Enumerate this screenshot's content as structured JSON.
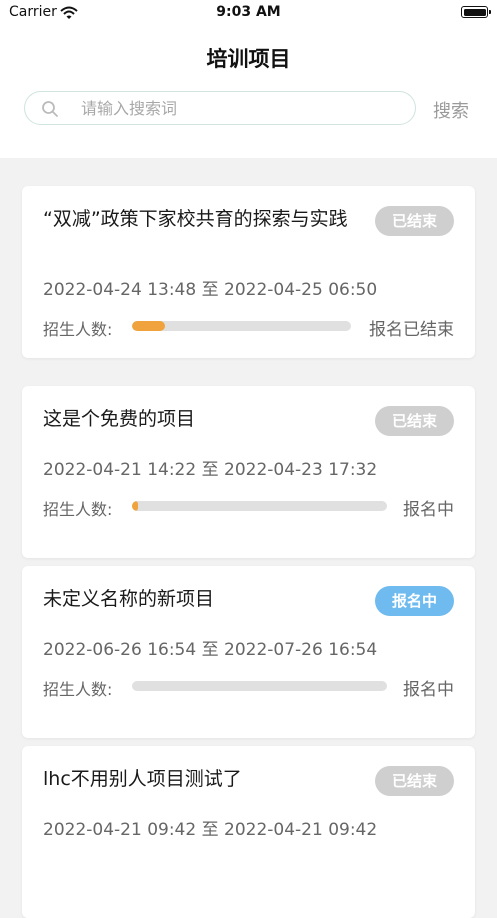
{
  "status_bar": {
    "carrier": "Carrier",
    "time": "9:03 AM"
  },
  "header": {
    "title": "培训项目"
  },
  "search": {
    "placeholder": "请输入搜索词",
    "button_label": "搜索"
  },
  "enroll_label": "招生人数:",
  "projects": [
    {
      "title": "“双减”政策下家校共育的探索与实践",
      "badge": "已结束",
      "date_range": "2022-04-24 13:48 至 2022-04-25 06:50",
      "enroll_status": "报名已结束",
      "progress": 0.15
    },
    {
      "title": "这是个免费的项目",
      "badge": "已结束",
      "date_range": "2022-04-21 14:22 至 2022-04-23 17:32",
      "enroll_status": "报名中",
      "progress": 0.02
    },
    {
      "title": "未定义名称的新项目",
      "badge": "报名中",
      "date_range": "2022-06-26 16:54 至 2022-07-26 16:54",
      "enroll_status": "报名中",
      "progress": 0.0
    },
    {
      "title": "lhc不用别人项目测试了",
      "badge": "已结束",
      "date_range": "2022-04-21 09:42 至 2022-04-21 09:42",
      "enroll_status": "",
      "progress": 0.0
    }
  ],
  "colors": {
    "progress_fill": "#f0a33d",
    "badge_ended": "#cfcfcf",
    "badge_open": "#6fbbf0"
  }
}
